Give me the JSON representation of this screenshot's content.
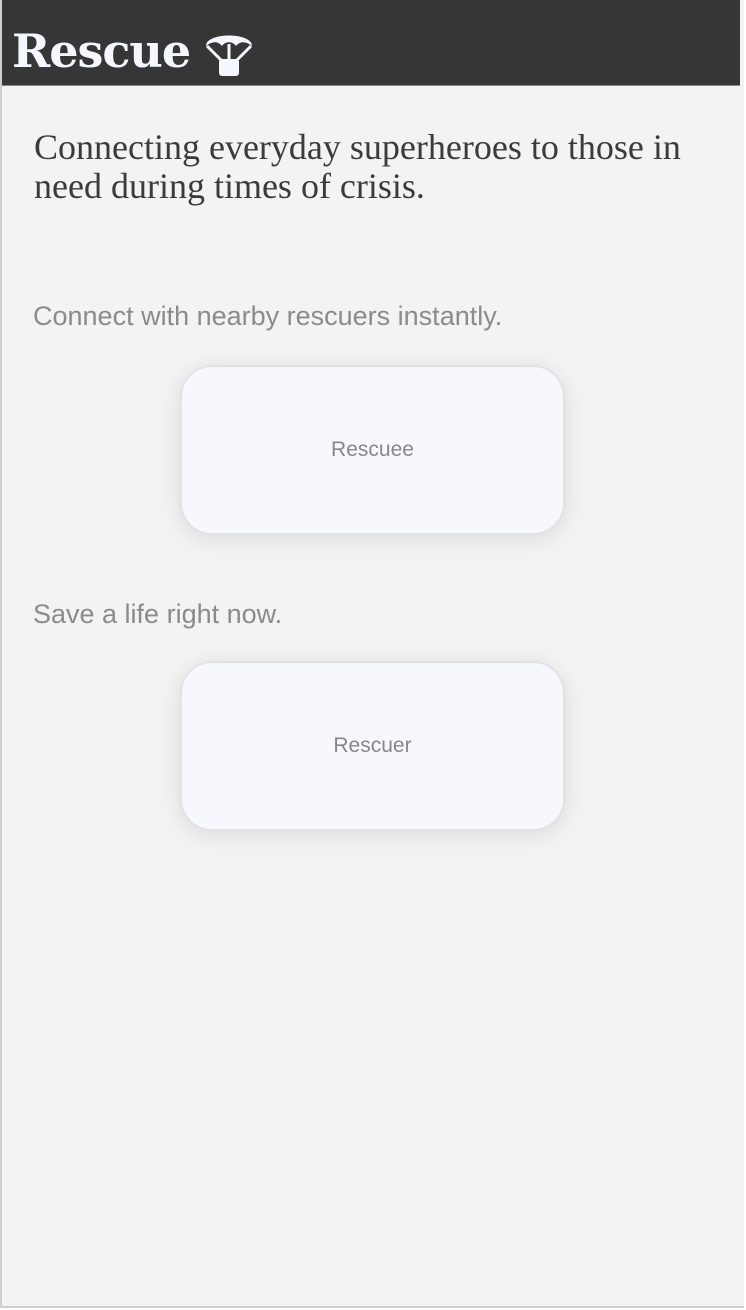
{
  "header": {
    "brand_name": "Rescue",
    "brand_icon": "parachute-icon",
    "background_color": "#363636",
    "brand_color": "#f5f7ff"
  },
  "hero": {
    "tagline": "Connecting everyday superheroes to those in need during times of crisis."
  },
  "options": [
    {
      "prompt": "Connect with nearby rescuers instantly.",
      "button_label": "Rescuee"
    },
    {
      "prompt": "Save a life right now.",
      "button_label": "Rescuer"
    }
  ],
  "colors": {
    "page_background": "#f3f3f3",
    "card_background": "#f7f8fd",
    "muted_text": "#8b8b8b",
    "heading_text": "#3b3b3b"
  }
}
